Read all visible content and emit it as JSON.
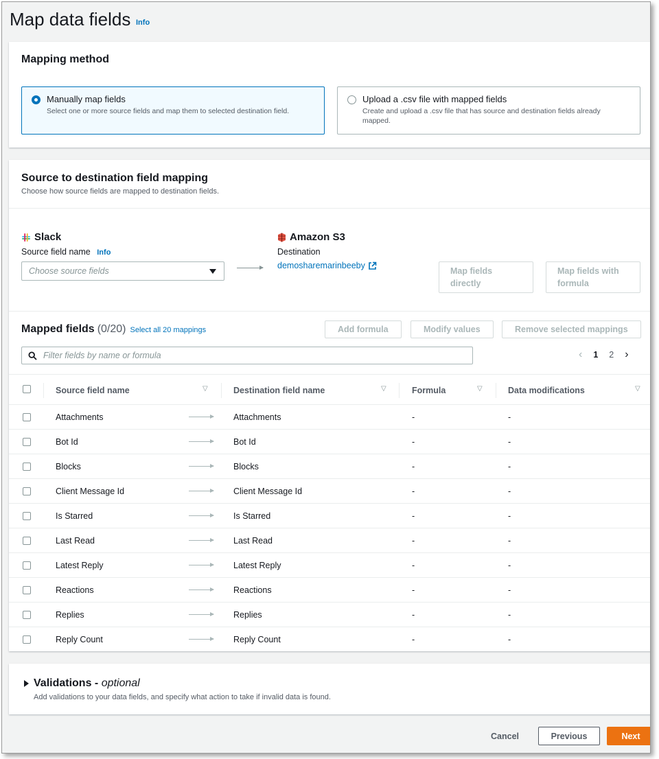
{
  "page": {
    "title": "Map data fields",
    "info": "Info"
  },
  "mapping_method": {
    "header": "Mapping method",
    "options": [
      {
        "title": "Manually map fields",
        "desc": "Select one or more source fields and map them to selected destination field.",
        "selected": true
      },
      {
        "title": "Upload a .csv file with mapped fields",
        "desc": "Create and upload a .csv file that has source and destination fields already mapped.",
        "selected": false
      }
    ]
  },
  "source_dest": {
    "header": "Source to destination field mapping",
    "desc": "Choose how source fields are mapped to destination fields.",
    "source_name": "Slack",
    "source_field_label": "Source field name",
    "source_info": "Info",
    "source_placeholder": "Choose source fields",
    "dest_name": "Amazon S3",
    "dest_label": "Destination",
    "dest_link": "demosharemarinbeeby",
    "btn_direct": "Map fields directly",
    "btn_formula": "Map fields with formula"
  },
  "mapped": {
    "title": "Mapped fields",
    "count": "(0/20)",
    "select_all": "Select all 20 mappings",
    "btn_add_formula": "Add formula",
    "btn_modify": "Modify values",
    "btn_remove": "Remove selected mappings",
    "filter_placeholder": "Filter fields by name or formula",
    "pages": [
      "1",
      "2"
    ],
    "columns": [
      "Source field name",
      "Destination field name",
      "Formula",
      "Data modifications"
    ],
    "rows": [
      {
        "source": "Attachments",
        "dest": "Attachments",
        "formula": "-",
        "mods": "-"
      },
      {
        "source": "Bot Id",
        "dest": "Bot Id",
        "formula": "-",
        "mods": "-"
      },
      {
        "source": "Blocks",
        "dest": "Blocks",
        "formula": "-",
        "mods": "-"
      },
      {
        "source": "Client Message Id",
        "dest": "Client Message Id",
        "formula": "-",
        "mods": "-"
      },
      {
        "source": "Is Starred",
        "dest": "Is Starred",
        "formula": "-",
        "mods": "-"
      },
      {
        "source": "Last Read",
        "dest": "Last Read",
        "formula": "-",
        "mods": "-"
      },
      {
        "source": "Latest Reply",
        "dest": "Latest Reply",
        "formula": "-",
        "mods": "-"
      },
      {
        "source": "Reactions",
        "dest": "Reactions",
        "formula": "-",
        "mods": "-"
      },
      {
        "source": "Replies",
        "dest": "Replies",
        "formula": "-",
        "mods": "-"
      },
      {
        "source": "Reply Count",
        "dest": "Reply Count",
        "formula": "-",
        "mods": "-"
      }
    ]
  },
  "validations": {
    "title": "Validations - ",
    "title_optional": "optional",
    "desc": "Add validations to your data fields, and specify what action to take if invalid data is found."
  },
  "footer": {
    "cancel": "Cancel",
    "previous": "Previous",
    "next": "Next"
  },
  "colors": {
    "accent": "#0073bb",
    "primary": "#ec7211",
    "selected_tile_bg": "#f1faff"
  }
}
